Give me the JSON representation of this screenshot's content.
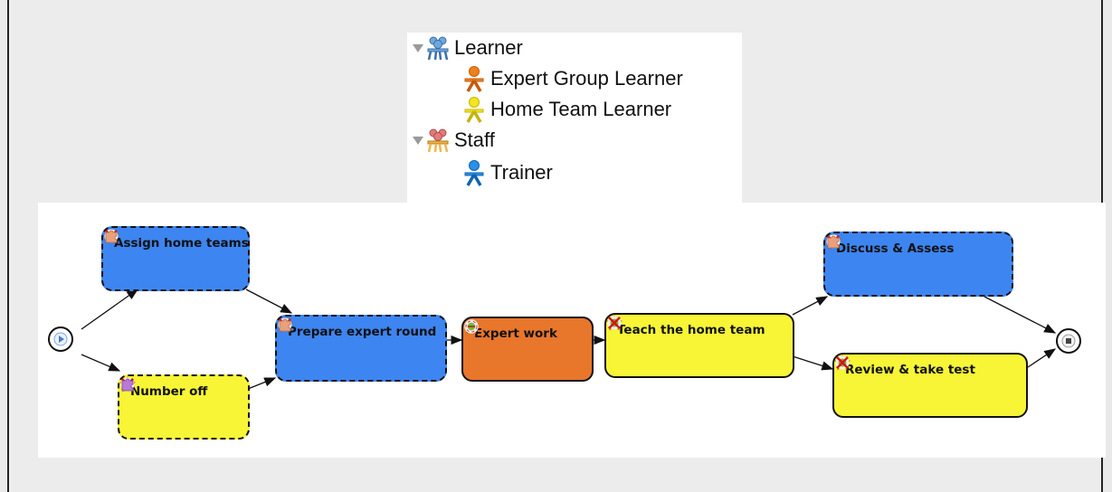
{
  "roles": {
    "groups": [
      {
        "label": "Learner",
        "icon": "learner-group-icon",
        "color": "#6fa8dc",
        "members": [
          {
            "label": "Expert Group Learner",
            "icon": "person-icon",
            "color": "#f0801e"
          },
          {
            "label": "Home Team Learner",
            "icon": "person-icon",
            "color": "#f5e51b"
          }
        ]
      },
      {
        "label": "Staff",
        "icon": "staff-group-icon",
        "color": "#e37b7b",
        "members": [
          {
            "label": "Trainer",
            "icon": "person-icon",
            "color": "#2a8fe8"
          }
        ]
      }
    ]
  },
  "diagram": {
    "start_icon": "start-node-icon",
    "end_icon": "end-node-icon",
    "activities": [
      {
        "id": "assign",
        "label": "Assign home teams",
        "color": "#3d85f0",
        "border": "dashed",
        "icons": [
          "star-icon",
          "crossed-puzzle-icon",
          "crossed-ring-icon",
          "puzzle-icon"
        ]
      },
      {
        "id": "number",
        "label": "Number off",
        "color": "#f7f536",
        "border": "dashed",
        "icons": [
          "star-icon",
          "crossed-puzzle-icon",
          "crossed-ring-icon",
          "puzzle-icon"
        ]
      },
      {
        "id": "prepare",
        "label": "Prepare expert round",
        "color": "#3d85f0",
        "border": "dashed",
        "icons": [
          "star-icon",
          "crossed-puzzle-icon",
          "crossed-ring-icon",
          "puzzle-icon"
        ]
      },
      {
        "id": "expert",
        "label": "Expert work",
        "color": "#e8762b",
        "border": "solid",
        "icons": [
          "star-icon",
          "puzzle-icon",
          "ring-icon"
        ]
      },
      {
        "id": "teach",
        "label": "Teach the home team",
        "color": "#f7f536",
        "border": "solid",
        "icons": [
          "star-icon",
          "crossed-puzzle-icon",
          "crossed-ring-icon"
        ]
      },
      {
        "id": "discuss",
        "label": "Discuss & Assess",
        "color": "#3d85f0",
        "border": "dashed",
        "icons": [
          "star-icon",
          "crossed-puzzle-icon",
          "crossed-ring-icon",
          "puzzle-icon"
        ]
      },
      {
        "id": "review",
        "label": "Review & take test",
        "color": "#f7f536",
        "border": "solid",
        "icons": [
          "star-icon",
          "crossed-puzzle-icon",
          "crossed-ring-icon"
        ]
      }
    ],
    "edges": [
      [
        "start",
        "assign"
      ],
      [
        "start",
        "number"
      ],
      [
        "assign",
        "prepare"
      ],
      [
        "number",
        "prepare"
      ],
      [
        "prepare",
        "expert"
      ],
      [
        "expert",
        "teach"
      ],
      [
        "teach",
        "discuss"
      ],
      [
        "teach",
        "review"
      ],
      [
        "discuss",
        "end"
      ],
      [
        "review",
        "end"
      ]
    ]
  }
}
